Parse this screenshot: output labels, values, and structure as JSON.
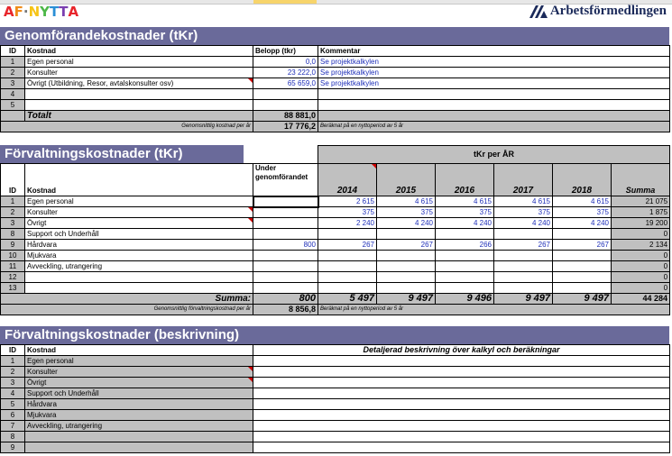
{
  "logo_text": [
    "A",
    "F",
    "·",
    "N",
    "Y",
    "T",
    "T",
    "A"
  ],
  "logo_colors": [
    "#e8252b",
    "#f08c1a",
    "#777777",
    "#f6c417",
    "#4db848",
    "#2a8fd6",
    "#7a3fb0",
    "#e8252b"
  ],
  "brand": "Arbetsförmedlingen",
  "section1": {
    "title": "Genomförandekostnader (tKr)",
    "headers": [
      "ID",
      "Kostnad",
      "Belopp (tkr)",
      "Kommentar"
    ],
    "rows": [
      {
        "id": "1",
        "kostnad": "Egen personal",
        "belopp": "0,0",
        "kommentar": "Se projektkalkylen"
      },
      {
        "id": "2",
        "kostnad": "Konsulter",
        "belopp": "23 222,0",
        "kommentar": "Se projektkalkylen"
      },
      {
        "id": "3",
        "kostnad": "Övrigt (Utbildning, Resor, avtalskonsulter osv)",
        "belopp": "65 659,0",
        "kommentar": "Se projektkalkylen"
      },
      {
        "id": "4",
        "kostnad": "",
        "belopp": "",
        "kommentar": ""
      },
      {
        "id": "5",
        "kostnad": "",
        "belopp": "",
        "kommentar": ""
      }
    ],
    "total_label": "Totalt",
    "total_value": "88 881,0",
    "avg_label": "Genomsnittlig kostnad per år",
    "avg_value": "17 776,2",
    "avg_note": "Beräknat på en nyttoperiod av 5 år"
  },
  "section2": {
    "title": "Förvaltningskostnader (tKr)",
    "year_header": "tKr per ÅR",
    "headers": [
      "ID",
      "Kostnad",
      "Under genomförandet"
    ],
    "years": [
      "2014",
      "2015",
      "2016",
      "2017",
      "2018"
    ],
    "summa_header": "Summa",
    "rows": [
      {
        "id": "1",
        "kostnad": "Egen personal",
        "under": "",
        "y": [
          "2 615",
          "4 615",
          "4 615",
          "4 615",
          "4 615"
        ],
        "summa": "21 075"
      },
      {
        "id": "2",
        "kostnad": "Konsulter",
        "under": "",
        "y": [
          "375",
          "375",
          "375",
          "375",
          "375"
        ],
        "summa": "1 875"
      },
      {
        "id": "3",
        "kostnad": "Övrigt",
        "under": "",
        "y": [
          "2 240",
          "4 240",
          "4 240",
          "4 240",
          "4 240"
        ],
        "summa": "19 200"
      },
      {
        "id": "8",
        "kostnad": "Support och Underhåll",
        "under": "",
        "y": [
          "",
          "",
          "",
          "",
          ""
        ],
        "summa": "0"
      },
      {
        "id": "9",
        "kostnad": "Hårdvara",
        "under": "800",
        "y": [
          "267",
          "267",
          "266",
          "267",
          "267"
        ],
        "summa": "2 134"
      },
      {
        "id": "10",
        "kostnad": "Mjukvara",
        "under": "",
        "y": [
          "",
          "",
          "",
          "",
          ""
        ],
        "summa": "0"
      },
      {
        "id": "11",
        "kostnad": "Avveckling, utrangering",
        "under": "",
        "y": [
          "",
          "",
          "",
          "",
          ""
        ],
        "summa": "0"
      },
      {
        "id": "12",
        "kostnad": "",
        "under": "",
        "y": [
          "",
          "",
          "",
          "",
          ""
        ],
        "summa": "0"
      },
      {
        "id": "13",
        "kostnad": "",
        "under": "",
        "y": [
          "",
          "",
          "",
          "",
          ""
        ],
        "summa": "0"
      }
    ],
    "summa_label": "Summa:",
    "summa_under": "800",
    "summa_years": [
      "5 497",
      "9 497",
      "9 496",
      "9 497",
      "9 497"
    ],
    "summa_total": "44 284",
    "avg_label": "Genomsnittlig förvaltningskostnad per år",
    "avg_value": "8 856,8",
    "avg_note": "Beräknat på en nyttoperiod av 5 år"
  },
  "section3": {
    "title": "Förvaltningskostnader (beskrivning)",
    "headers": [
      "ID",
      "Kostnad"
    ],
    "desc_header": "Detaljerad beskrivning över kalkyl och beräkningar",
    "rows": [
      {
        "id": "1",
        "kostnad": "Egen personal"
      },
      {
        "id": "2",
        "kostnad": "Konsulter"
      },
      {
        "id": "3",
        "kostnad": "Övrigt"
      },
      {
        "id": "4",
        "kostnad": "Support och Underhåll"
      },
      {
        "id": "5",
        "kostnad": "Hårdvara"
      },
      {
        "id": "6",
        "kostnad": "Mjukvara"
      },
      {
        "id": "7",
        "kostnad": "Avveckling, utrangering"
      },
      {
        "id": "8",
        "kostnad": ""
      },
      {
        "id": "9",
        "kostnad": ""
      }
    ]
  }
}
